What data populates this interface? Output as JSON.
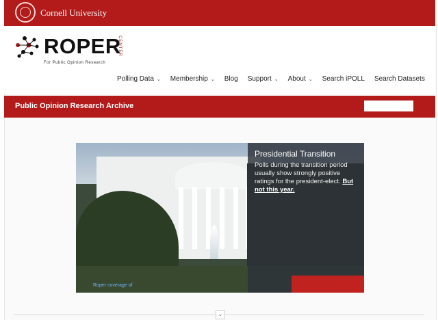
{
  "top_bar": {
    "university": "Cornell University"
  },
  "logo": {
    "name": "ROPER",
    "center": "CENTER",
    "tagline": "For Public Opinion Research"
  },
  "nav": {
    "items": [
      {
        "label": "Polling Data",
        "has_dropdown": true
      },
      {
        "label": "Membership",
        "has_dropdown": true
      },
      {
        "label": "Blog",
        "has_dropdown": false
      },
      {
        "label": "Support",
        "has_dropdown": true
      },
      {
        "label": "About",
        "has_dropdown": true
      },
      {
        "label": "Search iPOLL",
        "has_dropdown": false
      },
      {
        "label": "Search Datasets",
        "has_dropdown": false
      }
    ]
  },
  "archive": {
    "title": "Public Opinion Research Archive",
    "search_placeholder": ""
  },
  "hero": {
    "title": "Presidential Transition",
    "text": "Polls during the transition period usually show strongly positive ratings for the president-elect.",
    "link": "But not this year.",
    "coverage_link": "Roper coverage of"
  },
  "icons": {
    "caret": "chevron-down-icon",
    "scroll": "chevron-down-icon"
  },
  "colors": {
    "brand_red": "#b31b1b",
    "overlay": "#2d323a"
  }
}
